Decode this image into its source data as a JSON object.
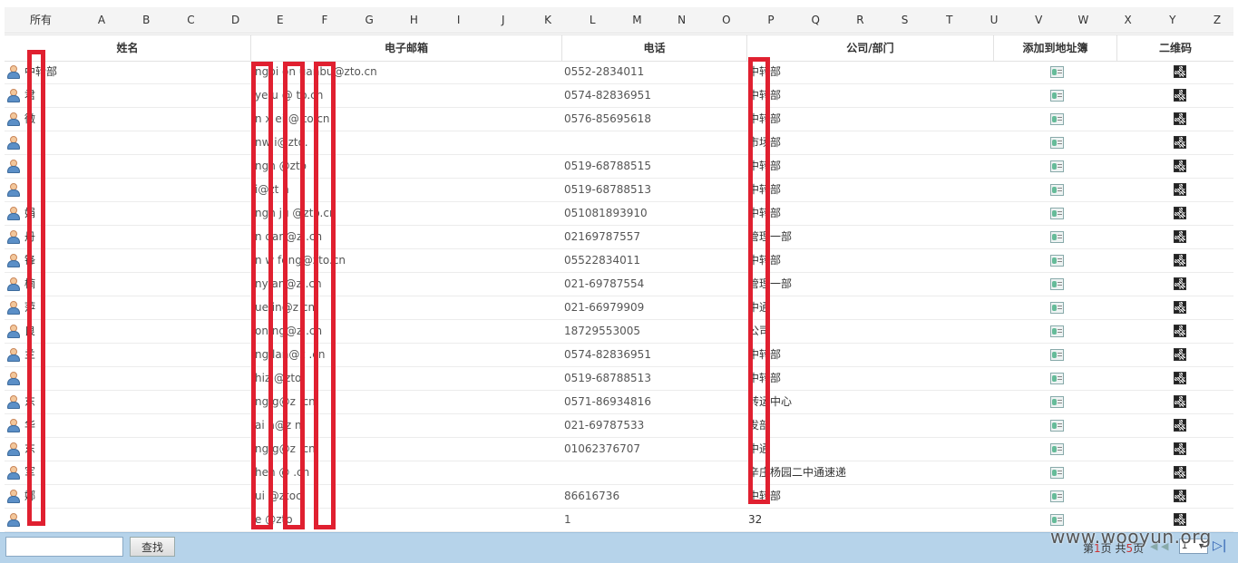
{
  "alpha_filter": {
    "all_label": "所有",
    "letters": [
      "A",
      "B",
      "C",
      "D",
      "E",
      "F",
      "G",
      "H",
      "I",
      "J",
      "K",
      "L",
      "M",
      "N",
      "O",
      "P",
      "Q",
      "R",
      "S",
      "T",
      "U",
      "V",
      "W",
      "X",
      "Y",
      "Z"
    ]
  },
  "table": {
    "headers": {
      "name": "姓名",
      "email": "电子邮箱",
      "phone": "电话",
      "dept": "公司/部门",
      "add": "添加到地址簿",
      "qr": "二维码"
    },
    "rows": [
      {
        "name": "中转部",
        "email": "ngbi  on  uanbu@zto.cn",
        "phone": "0552-2834011",
        "dept": "中转部"
      },
      {
        "name": "君",
        "email": "  ye  u @  to.cn",
        "phone": "0574-82836951",
        "dept": "中转部"
      },
      {
        "name": "微",
        "email": "  n  x  ei @ to.cn",
        "phone": "0576-85695618",
        "dept": "中转部"
      },
      {
        "name": "",
        "email": "  nw  i@zto.",
        "phone": "",
        "dept": "市场部"
      },
      {
        "name": "",
        "email": "  ngh  @zto",
        "phone": "0519-68788515",
        "dept": "中转部"
      },
      {
        "name": "",
        "email": "  i@zt  n",
        "phone": "0519-68788513",
        "dept": "中转部"
      },
      {
        "name": "娟",
        "email": "  ngh  ju  @zto.cn",
        "phone": "051081893910",
        "dept": "中转部"
      },
      {
        "name": "丹",
        "email": "  n  dan@z  .cn",
        "phone": "02169787557",
        "dept": "管理一部"
      },
      {
        "name": "锋",
        "email": "  n  w  feng@zto.cn",
        "phone": "05522834011",
        "dept": "中转部"
      },
      {
        "name": "楠",
        "email": "  ny  an@z  .cn",
        "phone": "021-69787554",
        "dept": "管理一部"
      },
      {
        "name": "萍",
        "email": "  ue  in@z  cn",
        "phone": "021-66979909",
        "dept": "中通"
      },
      {
        "name": "良",
        "email": "  on  ng@z  .cn",
        "phone": "18729553005",
        "dept": "公司"
      },
      {
        "name": "兰",
        "email": "  ng  lan@z  .cn",
        "phone": "0574-82836951",
        "dept": "中转部"
      },
      {
        "name": "",
        "email": "  hiz  @zto",
        "phone": "0519-68788513",
        "dept": "中转部"
      },
      {
        "name": "东",
        "email": "  ng  g@z  .cn",
        "phone": "0571-86934816",
        "dept": "转运中心"
      },
      {
        "name": "华",
        "email": "  ai  a@z  n",
        "phone": "021-69787533",
        "dept": "发部"
      },
      {
        "name": "东",
        "email": "  ng  g@z  .cn",
        "phone": "01062376707",
        "dept": "中通"
      },
      {
        "name": "军",
        "email": "  hen  @  .cn",
        "phone": "",
        "dept": "辛庄杨园二中通速递"
      },
      {
        "name": "娜",
        "email": "  ui  @ztoc",
        "phone": "86616736",
        "dept": "中转部"
      },
      {
        "name": "",
        "email": "  e  @zto",
        "phone": "1",
        "dept": "32"
      }
    ]
  },
  "footer": {
    "search_placeholder": "",
    "search_button": "查找",
    "pager_prefix": "第",
    "pager_current": "1",
    "pager_middle": "页 共",
    "pager_total": "5",
    "pager_suffix": "页",
    "page_select_value": "1"
  },
  "watermark": "www.wooyun.org",
  "colors": {
    "redaction": "#e02030",
    "footer_bg": "#b6d3ea"
  }
}
